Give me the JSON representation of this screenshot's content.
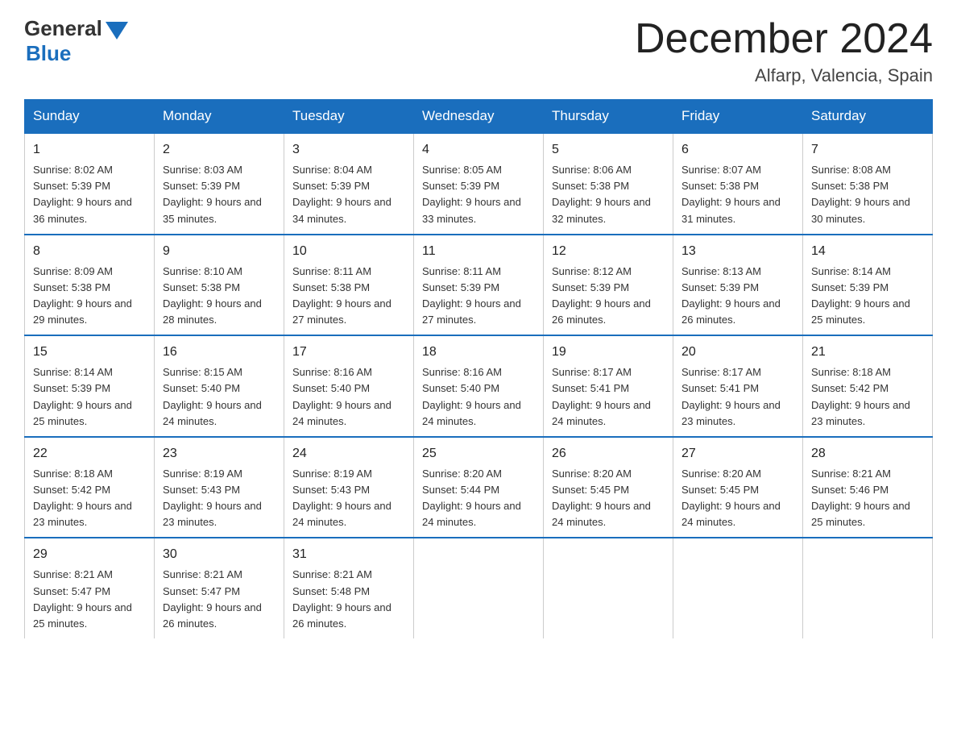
{
  "header": {
    "logo_general": "General",
    "logo_blue": "Blue",
    "month_title": "December 2024",
    "location": "Alfarp, Valencia, Spain"
  },
  "weekdays": [
    "Sunday",
    "Monday",
    "Tuesday",
    "Wednesday",
    "Thursday",
    "Friday",
    "Saturday"
  ],
  "weeks": [
    [
      {
        "day": "1",
        "sunrise": "8:02 AM",
        "sunset": "5:39 PM",
        "daylight": "9 hours and 36 minutes."
      },
      {
        "day": "2",
        "sunrise": "8:03 AM",
        "sunset": "5:39 PM",
        "daylight": "9 hours and 35 minutes."
      },
      {
        "day": "3",
        "sunrise": "8:04 AM",
        "sunset": "5:39 PM",
        "daylight": "9 hours and 34 minutes."
      },
      {
        "day": "4",
        "sunrise": "8:05 AM",
        "sunset": "5:39 PM",
        "daylight": "9 hours and 33 minutes."
      },
      {
        "day": "5",
        "sunrise": "8:06 AM",
        "sunset": "5:38 PM",
        "daylight": "9 hours and 32 minutes."
      },
      {
        "day": "6",
        "sunrise": "8:07 AM",
        "sunset": "5:38 PM",
        "daylight": "9 hours and 31 minutes."
      },
      {
        "day": "7",
        "sunrise": "8:08 AM",
        "sunset": "5:38 PM",
        "daylight": "9 hours and 30 minutes."
      }
    ],
    [
      {
        "day": "8",
        "sunrise": "8:09 AM",
        "sunset": "5:38 PM",
        "daylight": "9 hours and 29 minutes."
      },
      {
        "day": "9",
        "sunrise": "8:10 AM",
        "sunset": "5:38 PM",
        "daylight": "9 hours and 28 minutes."
      },
      {
        "day": "10",
        "sunrise": "8:11 AM",
        "sunset": "5:38 PM",
        "daylight": "9 hours and 27 minutes."
      },
      {
        "day": "11",
        "sunrise": "8:11 AM",
        "sunset": "5:39 PM",
        "daylight": "9 hours and 27 minutes."
      },
      {
        "day": "12",
        "sunrise": "8:12 AM",
        "sunset": "5:39 PM",
        "daylight": "9 hours and 26 minutes."
      },
      {
        "day": "13",
        "sunrise": "8:13 AM",
        "sunset": "5:39 PM",
        "daylight": "9 hours and 26 minutes."
      },
      {
        "day": "14",
        "sunrise": "8:14 AM",
        "sunset": "5:39 PM",
        "daylight": "9 hours and 25 minutes."
      }
    ],
    [
      {
        "day": "15",
        "sunrise": "8:14 AM",
        "sunset": "5:39 PM",
        "daylight": "9 hours and 25 minutes."
      },
      {
        "day": "16",
        "sunrise": "8:15 AM",
        "sunset": "5:40 PM",
        "daylight": "9 hours and 24 minutes."
      },
      {
        "day": "17",
        "sunrise": "8:16 AM",
        "sunset": "5:40 PM",
        "daylight": "9 hours and 24 minutes."
      },
      {
        "day": "18",
        "sunrise": "8:16 AM",
        "sunset": "5:40 PM",
        "daylight": "9 hours and 24 minutes."
      },
      {
        "day": "19",
        "sunrise": "8:17 AM",
        "sunset": "5:41 PM",
        "daylight": "9 hours and 24 minutes."
      },
      {
        "day": "20",
        "sunrise": "8:17 AM",
        "sunset": "5:41 PM",
        "daylight": "9 hours and 23 minutes."
      },
      {
        "day": "21",
        "sunrise": "8:18 AM",
        "sunset": "5:42 PM",
        "daylight": "9 hours and 23 minutes."
      }
    ],
    [
      {
        "day": "22",
        "sunrise": "8:18 AM",
        "sunset": "5:42 PM",
        "daylight": "9 hours and 23 minutes."
      },
      {
        "day": "23",
        "sunrise": "8:19 AM",
        "sunset": "5:43 PM",
        "daylight": "9 hours and 23 minutes."
      },
      {
        "day": "24",
        "sunrise": "8:19 AM",
        "sunset": "5:43 PM",
        "daylight": "9 hours and 24 minutes."
      },
      {
        "day": "25",
        "sunrise": "8:20 AM",
        "sunset": "5:44 PM",
        "daylight": "9 hours and 24 minutes."
      },
      {
        "day": "26",
        "sunrise": "8:20 AM",
        "sunset": "5:45 PM",
        "daylight": "9 hours and 24 minutes."
      },
      {
        "day": "27",
        "sunrise": "8:20 AM",
        "sunset": "5:45 PM",
        "daylight": "9 hours and 24 minutes."
      },
      {
        "day": "28",
        "sunrise": "8:21 AM",
        "sunset": "5:46 PM",
        "daylight": "9 hours and 25 minutes."
      }
    ],
    [
      {
        "day": "29",
        "sunrise": "8:21 AM",
        "sunset": "5:47 PM",
        "daylight": "9 hours and 25 minutes."
      },
      {
        "day": "30",
        "sunrise": "8:21 AM",
        "sunset": "5:47 PM",
        "daylight": "9 hours and 26 minutes."
      },
      {
        "day": "31",
        "sunrise": "8:21 AM",
        "sunset": "5:48 PM",
        "daylight": "9 hours and 26 minutes."
      },
      null,
      null,
      null,
      null
    ]
  ]
}
